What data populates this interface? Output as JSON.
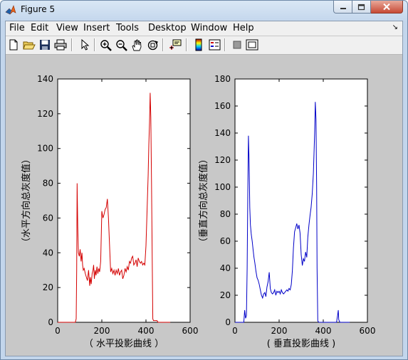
{
  "window": {
    "title": "Figure 5"
  },
  "menu": [
    "File",
    "Edit",
    "View",
    "Insert",
    "Tools",
    "Desktop",
    "Window",
    "Help"
  ],
  "menu_arrow": "↘",
  "toolbar": [
    "new-file-icon",
    "open-folder-icon",
    "save-icon",
    "print-icon",
    "pointer-icon",
    "zoom-in-icon",
    "zoom-out-icon",
    "pan-hand-icon",
    "rotate-3d-icon",
    "data-cursor-icon",
    "colorbar-icon",
    "legend-icon",
    "hide-plot-tools-icon",
    "show-plot-tools-icon"
  ],
  "chart_data": [
    {
      "type": "line",
      "color": "#d40000",
      "xlabel": "（ 水平投影曲线 ）",
      "ylabel": "（水平方向总灰度值）",
      "xlim": [
        0,
        600
      ],
      "ylim": [
        0,
        140
      ],
      "xticks": [
        0,
        200,
        400,
        600
      ],
      "yticks": [
        0,
        20,
        40,
        60,
        80,
        100,
        120,
        140
      ],
      "x": [
        0,
        80,
        84,
        86,
        88,
        91,
        94,
        98,
        102,
        106,
        110,
        113,
        116,
        120,
        125,
        130,
        135,
        140,
        145,
        148,
        152,
        156,
        160,
        163,
        166,
        170,
        174,
        178,
        182,
        186,
        190,
        195,
        200,
        205,
        210,
        215,
        220,
        225,
        230,
        235,
        240,
        245,
        250,
        255,
        260,
        265,
        270,
        275,
        280,
        285,
        290,
        295,
        300,
        305,
        310,
        315,
        320,
        325,
        330,
        335,
        340,
        345,
        350,
        355,
        360,
        365,
        370,
        375,
        380,
        385,
        390,
        395,
        400,
        405,
        410,
        413,
        416,
        419,
        422,
        425,
        428,
        431,
        434,
        437,
        440,
        445,
        450,
        455,
        460,
        465,
        470,
        475,
        480,
        490,
        500,
        510
      ],
      "y": [
        0,
        0,
        2,
        30,
        80,
        55,
        40,
        38,
        42,
        35,
        40,
        33,
        30,
        31,
        28,
        26,
        24,
        30,
        21,
        26,
        22,
        28,
        30,
        33,
        25,
        30,
        27,
        32,
        28,
        31,
        29,
        35,
        64,
        60,
        62,
        65,
        66,
        71,
        60,
        45,
        29,
        31,
        28,
        30,
        27,
        30,
        28,
        31,
        27,
        29,
        30,
        25,
        27,
        31,
        29,
        32,
        30,
        35,
        34,
        37,
        38,
        33,
        34,
        36,
        32,
        37,
        35,
        34,
        35,
        33,
        34,
        33,
        44,
        65,
        85,
        102,
        115,
        132,
        118,
        80,
        40,
        2,
        1,
        1,
        1,
        1,
        1,
        0,
        0,
        0,
        0,
        0,
        0,
        0,
        0,
        0
      ]
    },
    {
      "type": "line",
      "color": "#0000c8",
      "xlabel": "( 垂直投影曲线 )",
      "ylabel": "（垂直方向总灰度值）",
      "xlim": [
        0,
        600
      ],
      "ylim": [
        0,
        180
      ],
      "xticks": [
        0,
        200,
        400,
        600
      ],
      "yticks": [
        0,
        20,
        40,
        60,
        80,
        100,
        120,
        140,
        160,
        180
      ],
      "x": [
        0,
        40,
        44,
        48,
        52,
        55,
        58,
        61,
        64,
        67,
        70,
        74,
        78,
        82,
        86,
        90,
        95,
        100,
        105,
        110,
        115,
        120,
        125,
        130,
        135,
        140,
        145,
        150,
        155,
        160,
        165,
        170,
        175,
        180,
        185,
        190,
        195,
        200,
        205,
        210,
        215,
        220,
        225,
        230,
        235,
        240,
        245,
        250,
        255,
        260,
        265,
        270,
        275,
        280,
        285,
        290,
        295,
        300,
        305,
        310,
        315,
        320,
        325,
        330,
        335,
        340,
        345,
        350,
        355,
        358,
        361,
        364,
        367,
        370,
        372,
        375,
        380,
        390,
        400,
        420,
        440,
        460,
        465,
        468,
        470,
        475,
        480,
        500,
        520
      ],
      "y": [
        0,
        0,
        9,
        3,
        5,
        40,
        95,
        138,
        120,
        85,
        72,
        65,
        60,
        54,
        48,
        44,
        38,
        33,
        31,
        28,
        24,
        20,
        18,
        21,
        22,
        19,
        26,
        30,
        37,
        25,
        22,
        21,
        22,
        24,
        20,
        23,
        22,
        23,
        21,
        24,
        22,
        21,
        22,
        23,
        24,
        23,
        25,
        24,
        28,
        38,
        55,
        67,
        70,
        73,
        69,
        72,
        66,
        50,
        42,
        47,
        45,
        52,
        48,
        63,
        72,
        79,
        85,
        95,
        110,
        125,
        140,
        163,
        150,
        100,
        40,
        1,
        0,
        0,
        0,
        0,
        0,
        0,
        5,
        9,
        2,
        0,
        0,
        0,
        0
      ]
    }
  ]
}
